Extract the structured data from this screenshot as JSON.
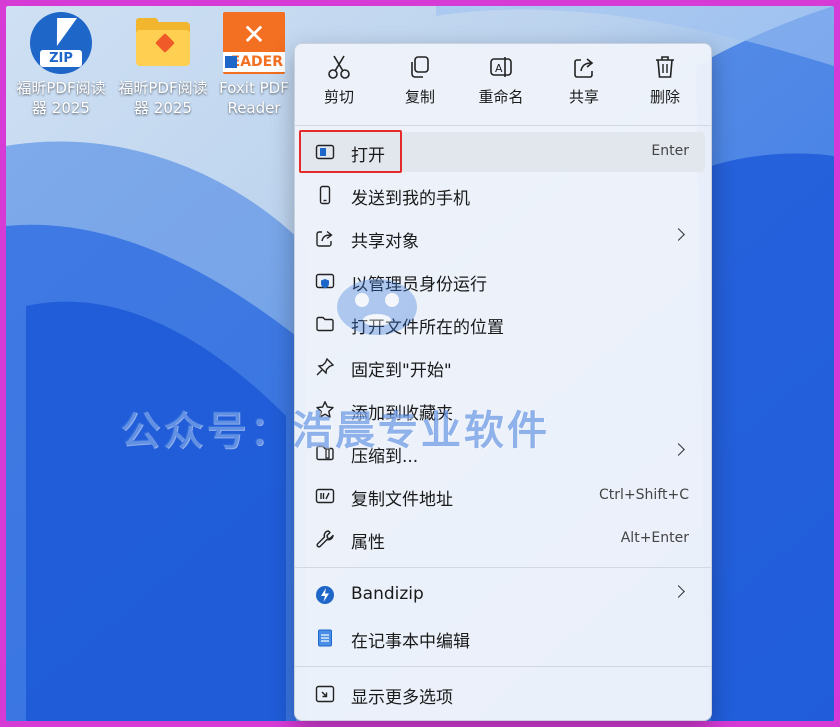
{
  "desktop": {
    "icons": [
      {
        "label": "福昕PDF阅读器 2025",
        "badge": "ZIP"
      },
      {
        "label": "福昕PDF阅读器 2025"
      },
      {
        "label": "Foxit PDF Reader",
        "badge": "EADER"
      }
    ]
  },
  "menu": {
    "quick_actions": [
      {
        "label": "剪切",
        "icon": "scissors-icon"
      },
      {
        "label": "复制",
        "icon": "copy-icon"
      },
      {
        "label": "重命名",
        "icon": "rename-icon"
      },
      {
        "label": "共享",
        "icon": "share-icon"
      },
      {
        "label": "删除",
        "icon": "trash-icon"
      }
    ],
    "items": [
      {
        "label": "打开",
        "shortcut": "Enter",
        "icon": "open-window-icon"
      },
      {
        "label": "发送到我的手机",
        "icon": "phone-icon"
      },
      {
        "label": "共享对象",
        "icon": "share-icon"
      },
      {
        "label": "以管理员身份运行",
        "icon": "shield-icon"
      },
      {
        "label": "打开文件所在的位置",
        "icon": "folder-icon"
      },
      {
        "label": "固定到\"开始\"",
        "icon": "pin-icon"
      },
      {
        "label": "添加到收藏夹",
        "icon": "star-icon"
      },
      {
        "label": "压缩到...",
        "icon": "zip-folder-icon"
      },
      {
        "label": "复制文件地址",
        "shortcut": "Ctrl+Shift+C",
        "icon": "path-icon"
      },
      {
        "label": "属性",
        "shortcut": "Alt+Enter",
        "icon": "wrench-icon"
      },
      {
        "label": "Bandizip",
        "icon": "bandizip-icon"
      },
      {
        "label": "在记事本中编辑",
        "icon": "notepad-icon"
      },
      {
        "label": "显示更多选项",
        "icon": "more-options-icon"
      }
    ]
  },
  "watermark": "公众号：浩晨专业软件",
  "colors": {
    "highlight_box": "#e32b2b",
    "accent": "#1f66c9"
  }
}
